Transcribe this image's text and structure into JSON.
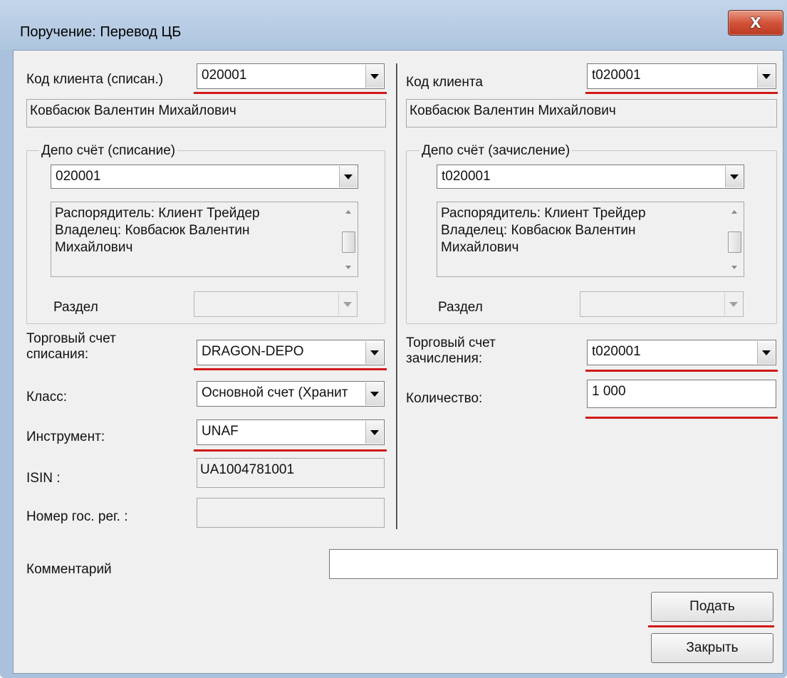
{
  "window": {
    "title": "Поручение: Перевод ЦБ",
    "close_glyph": "X"
  },
  "left": {
    "client_code_label": "Код клиента (списан.)",
    "client_code_value": "020001",
    "client_name": "Ковбасюк Валентин Михайлович",
    "depo_group_title": "Депо счёт (списание)",
    "depo_account_value": "020001",
    "depo_info": "Распорядитель: Клиент  Трейдер\nВладелец: Ковбасюк Валентин\nМихайлович",
    "section_label": "Раздел",
    "section_value": "",
    "trade_account_label": "Торговый счет\nсписания:",
    "trade_account_value": "DRAGON-DEPO",
    "class_label": "Класс:",
    "class_value": "Основной счет (Хранит",
    "instrument_label": "Инструмент:",
    "instrument_value": "UNAF",
    "isin_label": "ISIN :",
    "isin_value": "UA1004781001",
    "reg_label": "Номер гос. рег. :",
    "reg_value": ""
  },
  "right": {
    "client_code_label": "Код клиента",
    "client_code_value": "t020001",
    "client_name": "Ковбасюк Валентин Михайлович",
    "depo_group_title": "Депо счёт (зачисление)",
    "depo_account_value": "t020001",
    "depo_info": "Распорядитель: Клиент Трейдер\nВладелец: Ковбасюк Валентин\nМихайлович",
    "section_label": "Раздел",
    "section_value": "",
    "trade_account_label": "Торговый счет\nзачисления:",
    "trade_account_value": "t020001",
    "quantity_label": "Количество:",
    "quantity_value": "1 000"
  },
  "comment": {
    "label": "Комментарий",
    "value": ""
  },
  "buttons": {
    "submit": "Подать",
    "close": "Закрыть"
  },
  "colors": {
    "highlight": "#d11919",
    "titlebar": "#b7cce5",
    "close_button": "#c94a32"
  }
}
